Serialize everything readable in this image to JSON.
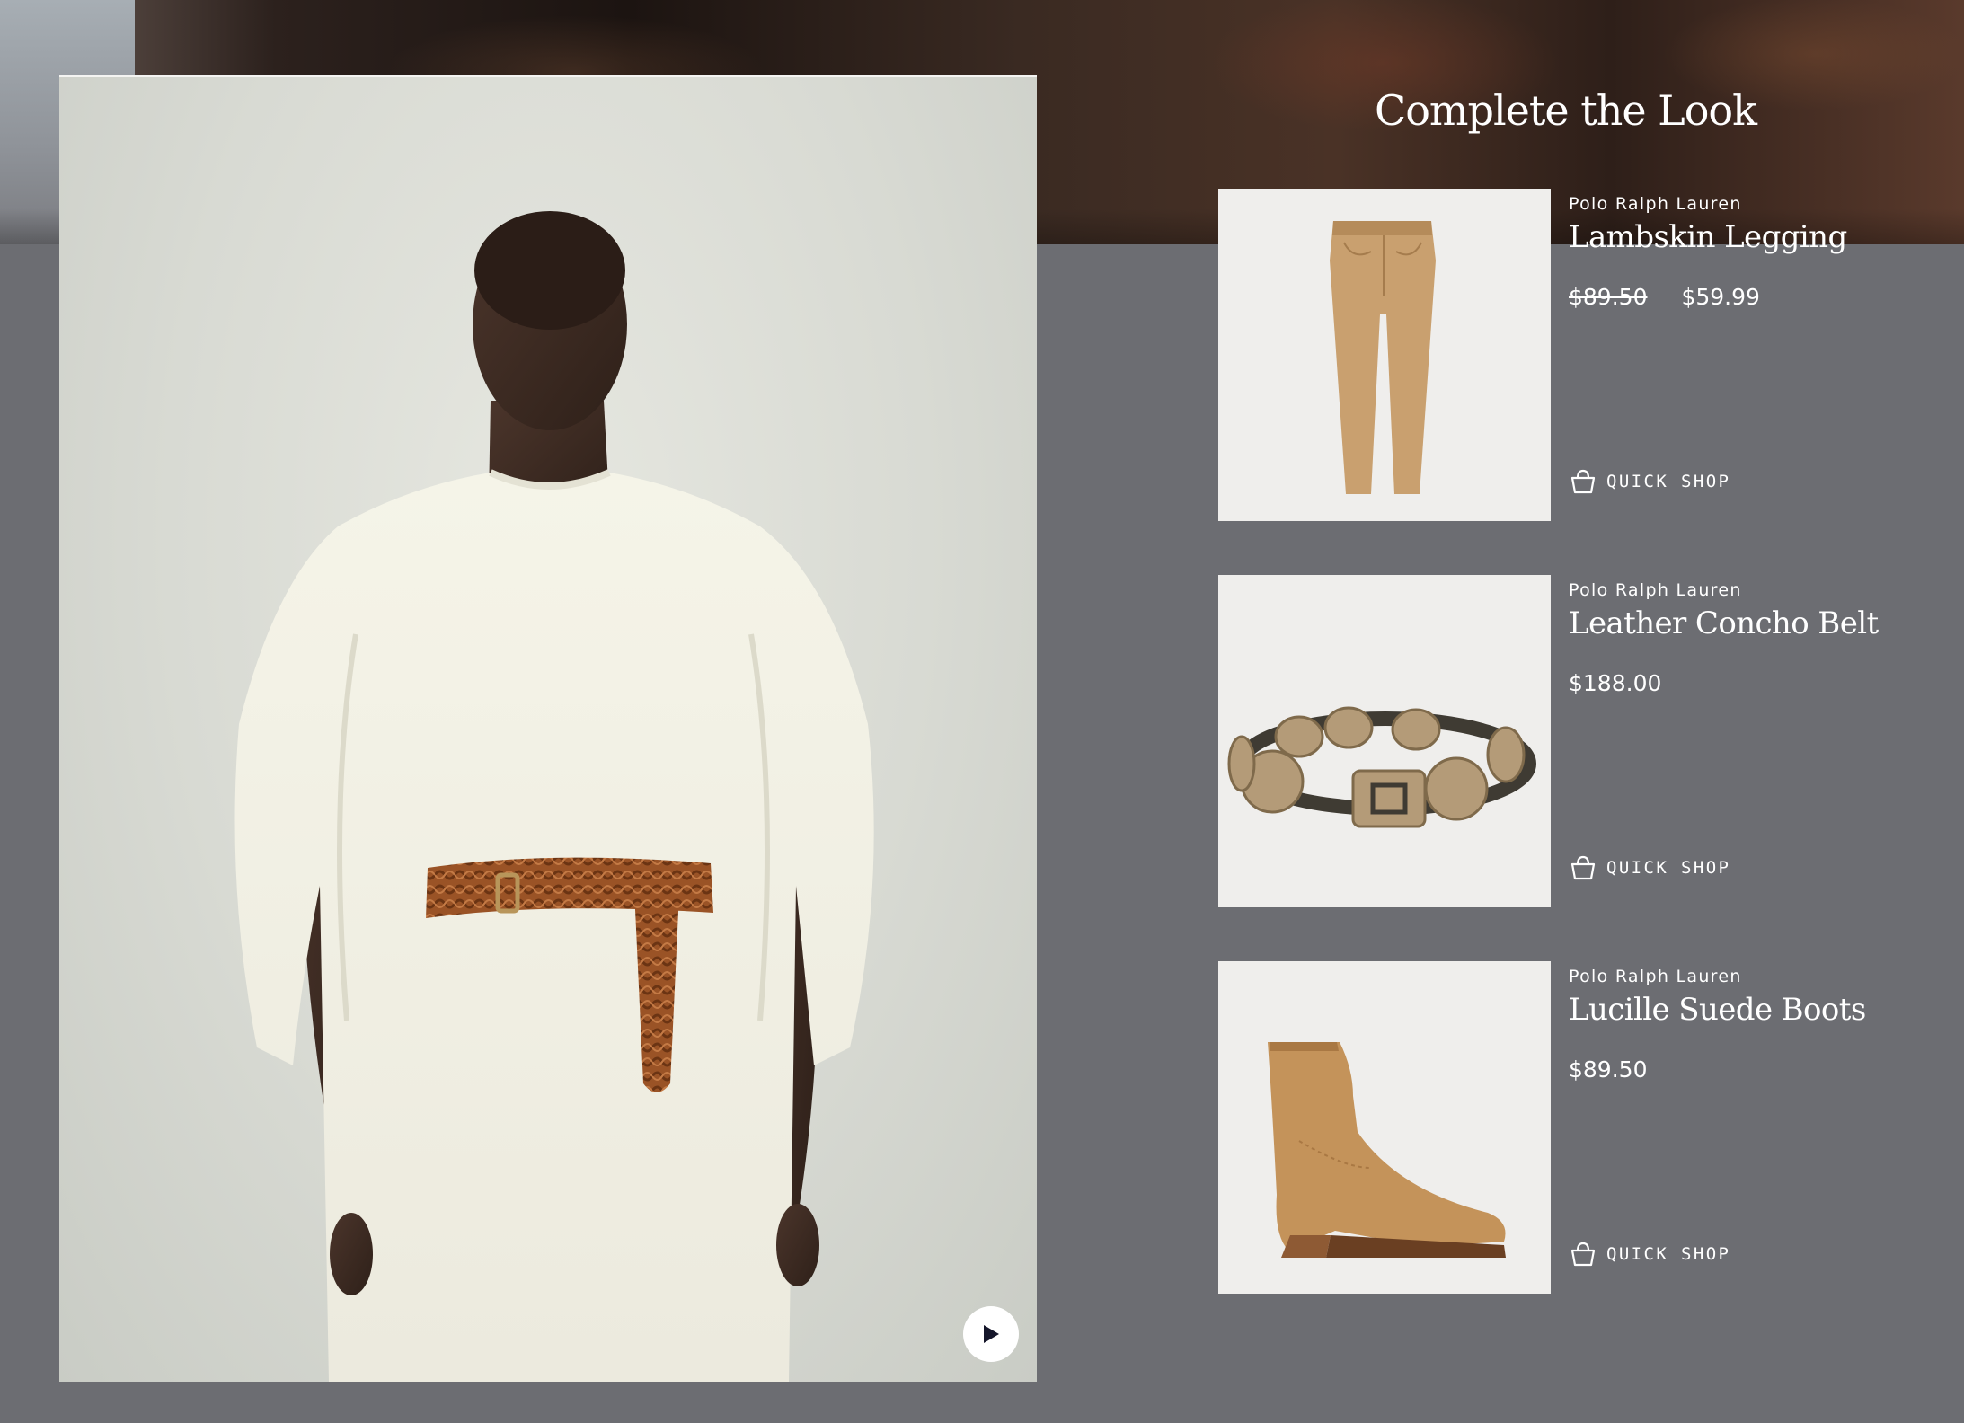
{
  "section_title": "Complete the Look",
  "hero": {
    "image_description": "Model wearing a long cream sweater dress with a braided cognac leather belt",
    "play_icon": "play-icon"
  },
  "products": [
    {
      "brand": "Polo Ralph Lauren",
      "name": "Lambskin Legging",
      "original_price": "$89.50",
      "price": "$59.99",
      "quick_shop_label": "QUICK SHOP",
      "quick_shop_icon": "basket-icon",
      "image": "tan lambskin leggings"
    },
    {
      "brand": "Polo Ralph Lauren",
      "name": "Leather Concho Belt",
      "price": "$188.00",
      "quick_shop_label": "QUICK SHOP",
      "quick_shop_icon": "basket-icon",
      "image": "dark leather belt with silver conchos"
    },
    {
      "brand": "Polo Ralph Lauren",
      "name": "Lucille Suede Boots",
      "price": "$89.50",
      "quick_shop_label": "QUICK SHOP",
      "quick_shop_icon": "basket-icon",
      "image": "tan suede ankle boot"
    }
  ],
  "colors": {
    "page_background": "#6c6d72",
    "text": "#ffffff",
    "thumb_background": "#efeeec"
  }
}
